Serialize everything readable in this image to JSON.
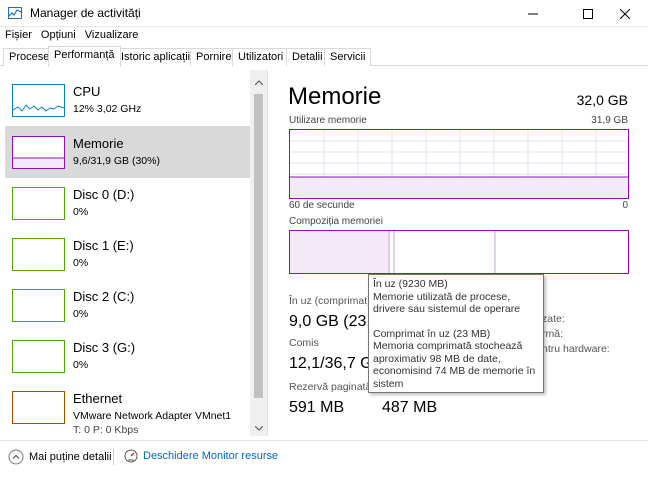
{
  "window": {
    "title": "Manager de activități"
  },
  "menu": [
    {
      "label": "Fișier"
    },
    {
      "label": "Opțiuni"
    },
    {
      "label": "Vizualizare"
    }
  ],
  "tabs": [
    {
      "label": "Procese"
    },
    {
      "label": "Performanță"
    },
    {
      "label": "Istoric aplicații"
    },
    {
      "label": "Pornire"
    },
    {
      "label": "Utilizatori"
    },
    {
      "label": "Detalii"
    },
    {
      "label": "Servicii"
    }
  ],
  "devices": [
    {
      "name": "CPU",
      "sub": "12%  3,02 GHz",
      "color": "#117dbb"
    },
    {
      "name": "Memorie",
      "sub": "9,6/31,9 GB (30%)",
      "color": "#8b12ae"
    },
    {
      "name": "Disc 0 (D:)",
      "sub": "0%",
      "color": "#4da60c"
    },
    {
      "name": "Disc 1 (E:)",
      "sub": "0%",
      "color": "#4da60c"
    },
    {
      "name": "Disc 2 (C:)",
      "sub": "0%",
      "color": "#4da60c"
    },
    {
      "name": "Disc 3 (G:)",
      "sub": "0%",
      "color": "#4da60c"
    },
    {
      "name": "Ethernet",
      "sub": "VMware Network Adapter VMnet1",
      "sub2": "T: 0  P: 0 Kbps",
      "color": "#a74f01"
    }
  ],
  "memory": {
    "title": "Memorie",
    "total": "32,0 GB",
    "usage_label": "Utilizare memorie",
    "usage_max": "31,9 GB",
    "time_label": "60 de secunde",
    "time_zero": "0",
    "composition_label": "Compoziția memoriei",
    "in_use_label": "În uz (comprimat)",
    "in_use_value": "9,0 GB (23,",
    "committed_label": "Comis",
    "committed_value": "12,1/36,7 G",
    "cached_label": "Rezervă paginată",
    "cached_value": "591 MB",
    "nonpaged_value": "487 MB",
    "right_label_1": "zate:",
    "right_label_2": "rmă:",
    "right_label_3": "ntru hardware:"
  },
  "tooltip": {
    "line1": "În uz (9230 MB)",
    "line2": "Memorie utilizată de procese, drivere sau sistemul de operare",
    "line3": "Comprimat în uz (23 MB)",
    "line4": "Memoria comprimată stochează aproximativ 98 MB de date, economisind 74 MB de memorie în sistem"
  },
  "footer": {
    "fewer_details": "Mai puține detalii",
    "open_monitor": "Deschidere Monitor resurse"
  },
  "colors": {
    "memory_accent": "#8b12ae",
    "cpu_accent": "#117dbb",
    "disk_accent": "#4da60c",
    "ethernet_accent": "#a74f01"
  }
}
